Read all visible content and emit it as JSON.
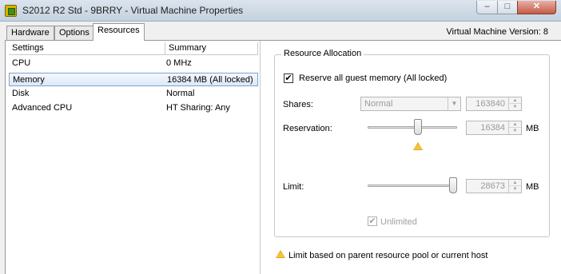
{
  "window": {
    "title": "S2012 R2 Std - 9BRRY - Virtual Machine Properties",
    "minimize_glyph": "–",
    "maximize_glyph": "□",
    "close_glyph": "✕"
  },
  "tabs": [
    {
      "label": "Hardware",
      "active": false
    },
    {
      "label": "Options",
      "active": false
    },
    {
      "label": "Resources",
      "active": true
    }
  ],
  "vm_version": "Virtual Machine Version: 8",
  "settings_table": {
    "columns": [
      "Settings",
      "Summary"
    ],
    "rows": [
      {
        "setting": "CPU",
        "summary": "0 MHz",
        "selected": false
      },
      {
        "setting": "Memory",
        "summary": "16384 MB (All locked)",
        "selected": true
      },
      {
        "setting": "Disk",
        "summary": "Normal",
        "selected": false
      },
      {
        "setting": "Advanced CPU",
        "summary": "HT Sharing: Any",
        "selected": false
      }
    ]
  },
  "allocation": {
    "group_title": "Resource Allocation",
    "reserve_all": {
      "label": "Reserve all guest memory (All locked)",
      "checked": true,
      "glyph": "✔"
    },
    "shares": {
      "label": "Shares:",
      "selected": "Normal",
      "value": "163840"
    },
    "reservation": {
      "label": "Reservation:",
      "value": "16384",
      "unit": "MB",
      "slider_fraction": 0.57
    },
    "limit": {
      "label": "Limit:",
      "value": "28673",
      "unit": "MB",
      "slider_fraction": 1.0
    },
    "unlimited": {
      "label": "Unlimited",
      "checked": true,
      "glyph": "✔"
    }
  },
  "warning_note": "Limit based on parent resource pool or current host",
  "colors": {
    "selection": "#dce9f8",
    "warning": "#e6a313"
  },
  "icons": [
    "vm-app-icon",
    "minimize-icon",
    "maximize-icon",
    "close-icon",
    "checkbox-check-icon",
    "dropdown-arrow-icon",
    "spin-up-icon",
    "spin-down-icon",
    "warning-icon"
  ]
}
